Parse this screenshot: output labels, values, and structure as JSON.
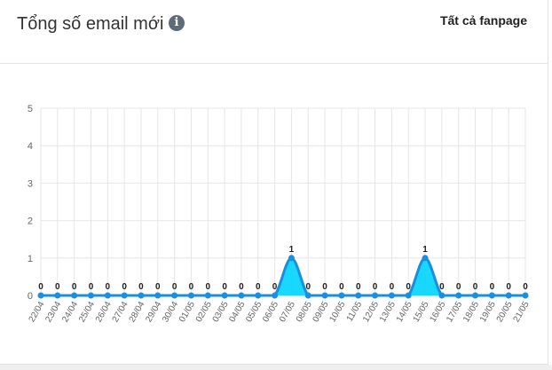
{
  "header": {
    "title": "Tổng số email mới",
    "info_icon": "info-icon",
    "filter_label": "Tất cả fanpage"
  },
  "colors": {
    "line": "#1a8fe0",
    "area": "#00d4ff",
    "grid": "#e6e6e6",
    "tick": "#666666"
  },
  "chart_data": {
    "type": "area",
    "title": "",
    "xlabel": "",
    "ylabel": "",
    "ylim": [
      0,
      5
    ],
    "yticks": [
      0,
      1,
      2,
      3,
      4,
      5
    ],
    "grid": true,
    "data_labels": true,
    "categories": [
      "22/04",
      "23/04",
      "24/04",
      "25/04",
      "26/04",
      "27/04",
      "28/04",
      "29/04",
      "30/04",
      "01/05",
      "02/05",
      "03/05",
      "04/05",
      "05/05",
      "06/05",
      "07/05",
      "08/05",
      "09/05",
      "10/05",
      "11/05",
      "12/05",
      "13/05",
      "14/05",
      "15/05",
      "16/05",
      "17/05",
      "18/05",
      "19/05",
      "20/05",
      "21/05"
    ],
    "series": [
      {
        "values": [
          0,
          0,
          0,
          0,
          0,
          0,
          0,
          0,
          0,
          0,
          0,
          0,
          0,
          0,
          0,
          1,
          0,
          0,
          0,
          0,
          0,
          0,
          0,
          1,
          0,
          0,
          0,
          0,
          0,
          0
        ]
      }
    ]
  }
}
